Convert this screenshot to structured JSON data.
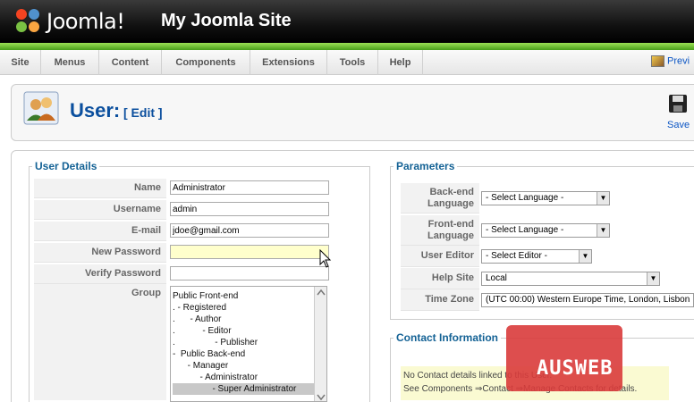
{
  "header": {
    "logo_text": "Joomla!",
    "site_title": "My Joomla Site"
  },
  "menu": {
    "items": [
      "Site",
      "Menus",
      "Content",
      "Components",
      "Extensions",
      "Tools",
      "Help"
    ],
    "preview_label": "Previ"
  },
  "toolbar": {
    "title": "User:",
    "subtitle": "[ Edit ]",
    "save_label": "Save"
  },
  "user_details": {
    "legend": "User Details",
    "fields": [
      {
        "label": "Name",
        "value": "Administrator"
      },
      {
        "label": "Username",
        "value": "admin"
      },
      {
        "label": "E-mail",
        "value": "jdoe@gmail.com"
      },
      {
        "label": "New Password",
        "value": ""
      },
      {
        "label": "Verify Password",
        "value": ""
      }
    ],
    "group_label": "Group",
    "groups": [
      "Public Front-end",
      ". - Registered",
      ".      - Author",
      ".           - Editor",
      ".                - Publisher",
      "-  Public Back-end",
      "      - Manager",
      "           - Administrator",
      "                - Super Administrator"
    ],
    "selected_group_index": 8
  },
  "parameters": {
    "legend": "Parameters",
    "rows": [
      {
        "label": "Back-end Language",
        "value": "- Select Language -"
      },
      {
        "label": "Front-end Language",
        "value": "- Select Language -"
      },
      {
        "label": "User Editor",
        "value": "- Select Editor -"
      },
      {
        "label": "Help Site",
        "value": "Local"
      },
      {
        "label": "Time Zone",
        "value": "(UTC 00:00) Western Europe Time, London, Lisbon"
      }
    ]
  },
  "contact": {
    "legend": "Contact Information",
    "line1": "No Contact details linked to this User.",
    "line2": "See Components ⇒Contact ⇒Manage Contacts for details."
  },
  "watermark": {
    "text": "AUSWEB"
  }
}
